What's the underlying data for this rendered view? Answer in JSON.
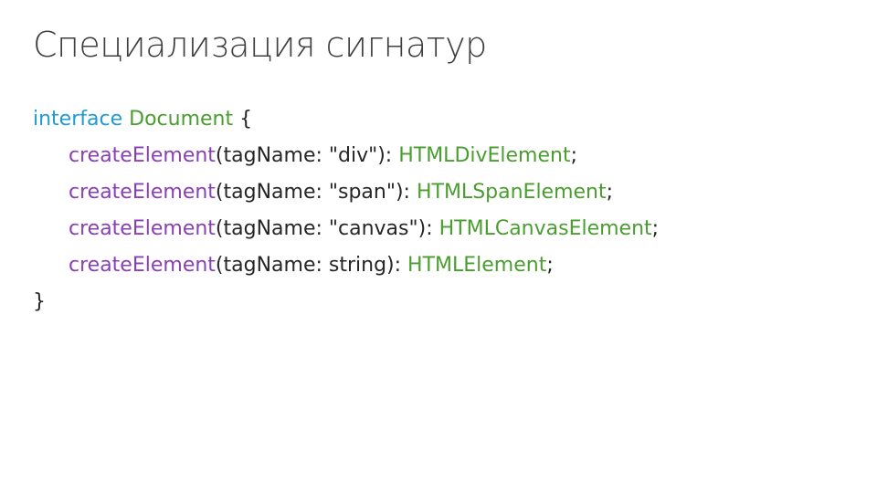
{
  "slide": {
    "title": "Специализация сигнатур"
  },
  "colors": {
    "keyword": "#1f9bd1",
    "type": "#4a9d2f",
    "function": "#8a3fb5",
    "text": "#262626",
    "title": "#3f3f3f"
  },
  "code": {
    "line0": {
      "keyword": "interface",
      "type": "Document",
      "brace": "{"
    },
    "methods": [
      {
        "name": "createElement",
        "params": "(tagName: \"div\"): ",
        "return_type": "HTMLDivElement",
        "end": ";"
      },
      {
        "name": "createElement",
        "params": "(tagName: \"span\"): ",
        "return_type": "HTMLSpanElement",
        "end": ";"
      },
      {
        "name": "createElement",
        "params": "(tagName: \"canvas\"): ",
        "return_type": "HTMLCanvasElement",
        "end": ";"
      },
      {
        "name": "createElement",
        "params": "(tagName: string): ",
        "return_type": "HTMLElement",
        "end": ";"
      }
    ],
    "closing_brace": "}"
  }
}
